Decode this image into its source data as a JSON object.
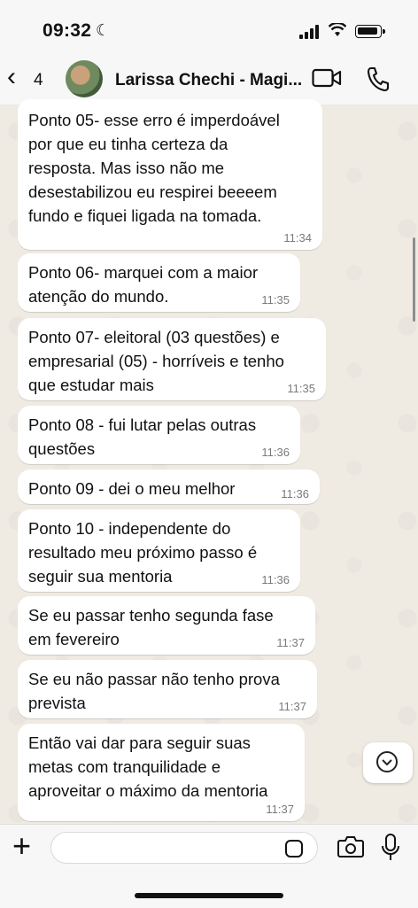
{
  "status_bar": {
    "time": "09:32",
    "moon": "☾"
  },
  "header": {
    "back_symbol": "‹",
    "unread_count": "4",
    "contact_name": "Larissa Chechi - Magi..."
  },
  "messages": [
    {
      "text": "Ponto 05- esse erro é imperdoável\npor que eu tinha certeza da\nresposta. Mas isso não me\ndesestabilizou eu respirei beeeem\nfundo e fiquei ligada na tomada.",
      "time": "11:34"
    },
    {
      "text": "Ponto 06- marquei com a maior\natenção do mundo.",
      "time": "11:35"
    },
    {
      "text": "Ponto 07- eleitoral (03 questões) e\nempresarial (05) - horríveis e tenho\nque estudar mais",
      "time": "11:35"
    },
    {
      "text": "Ponto 08 - fui lutar pelas outras\nquestões",
      "time": "11:36"
    },
    {
      "text": "Ponto 09 - dei o meu melhor",
      "time": "11:36"
    },
    {
      "text": "Ponto 10 - independente do\nresultado meu próximo passo é\nseguir sua mentoria",
      "time": "11:36"
    },
    {
      "text": "Se eu passar tenho segunda fase\nem fevereiro",
      "time": "11:37"
    },
    {
      "text": "Se eu não passar não tenho prova\nprevista",
      "time": "11:37"
    },
    {
      "text": "Então vai dar para seguir suas\nmetas com tranquilidade e\naproveitar o máximo da mentoria",
      "time": "11:37"
    }
  ],
  "composer": {
    "plus": "+"
  },
  "icons": {
    "video": "video-call-icon",
    "phone": "phone-icon",
    "camera": "camera-icon",
    "mic": "microphone-icon",
    "sticker": "sticker-icon",
    "scroll": "chevron-down-icon"
  }
}
